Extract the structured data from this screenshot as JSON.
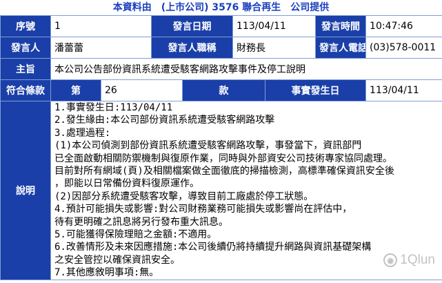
{
  "header": {
    "title": "本資料由　(上市公司) 3576 聯合再生　公司提供"
  },
  "fields": {
    "serial_label": "序號",
    "serial_value": "1",
    "date_label": "發言日期",
    "date_value": "113/04/11",
    "time_label": "發言時間",
    "time_value": "10:47:46",
    "speaker_label": "發言人",
    "speaker_value": "潘蕾蕾",
    "title_label": "發言人職稱",
    "title_value": "財務長",
    "phone_label": "發言人電話",
    "phone_value": "(03)578-0011",
    "subject_label": "主旨",
    "subject_value": "本公司公告部份資訊系統遭受駭客網路攻擊事件及停工說明",
    "clause_label": "符合條款",
    "article_label": "第",
    "article_value": "26",
    "item_label": "款",
    "fact_date_label": "事實發生日",
    "fact_date_value": "113/04/11",
    "desc_label": "說明"
  },
  "description_lines": [
    "1.事實發生日:113/04/11",
    "2.發生緣由:本公司部份資訊系統遭受駭客網路攻擊",
    "3.處理過程:",
    "(1)本公司偵測到部份資訊系統遭受駭客網路攻擊，事發當下，資訊部門",
    "已全面啟動相關防禦機制與復原作業，同時與外部資安公司技術專家協同處理。",
    "目前對所有網域(頁)及相關檔案做全面徹底的掃描檢測，高標準確保資訊安全後",
    "，即能以日常備份資料復原運作。",
    "(2)因部分系統遭受駭客攻擊，導致目前工廠處於停工狀態。",
    "4.預計可能損失或影響:對公司財務業務可能損失或影響尚在評估中，",
    "待有更明確之訊息將另行發布重大訊息。",
    "5.可能獲得保險理賠之金額:不適用。",
    "6.改善情形及未來因應措施:本公司後續仍將持續提升網路與資訊基礎架構",
    "之安全管控以確保資訊安全。",
    "7.其他應敘明事項:無。"
  ],
  "watermark": {
    "text": "1Qlun",
    "icon": "circle-logo-icon"
  }
}
